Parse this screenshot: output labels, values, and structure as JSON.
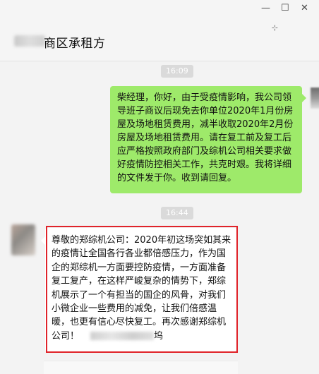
{
  "window": {
    "controls": {
      "minimize": "—",
      "restore": "☐",
      "close": "✕",
      "pin": "⊹"
    }
  },
  "chat": {
    "title": "商区承租方"
  },
  "messages": [
    {
      "time": "16:09",
      "text": "柴经理，你好，由于受疫情影响，我公司领导班子商议后现免去你单位2020年1月份房屋及场地租赁费用，减半收取2020年2月份房屋及场地租赁费用。请在复工前及复工后应严格按照政府部门及综机公司相关要求做好疫情防控相关工作，共克时艰。我将详细的文件发于你。收到请回复。"
    },
    {
      "time": "16:44",
      "text": "尊敬的郑综机公司：2020年初这场突如其来的疫情让全国各行各业都倍感压力，作为国企的郑综机一方面要控防疫情，一方面准备复工复产，在这样严峻复杂的情势下，郑综机展示了一个有担当的国企的风骨，对我们小微企业一些费用的减免，让我们倍感温暖，也更有信心尽快复工。再次感谢郑综机公司！",
      "signature_tail": "坞"
    }
  ],
  "colors": {
    "sent_bubble": "#9eea6a",
    "highlight_box": "#e0232a"
  }
}
